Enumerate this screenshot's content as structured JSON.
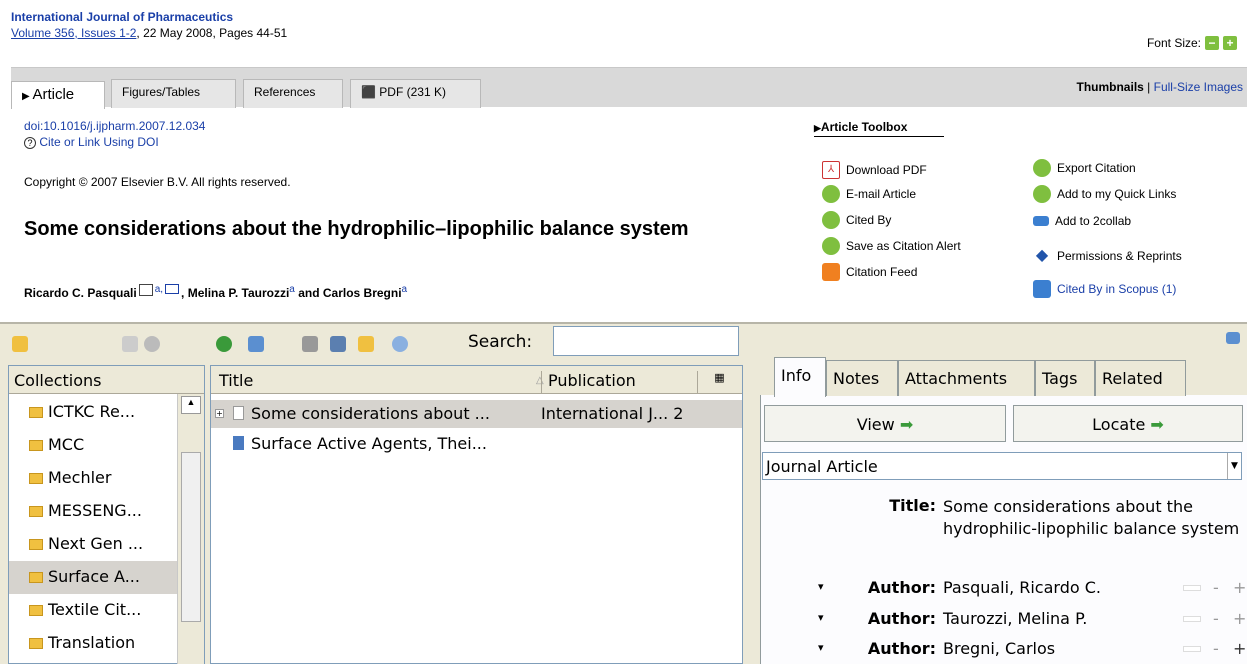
{
  "journal": {
    "name": "International Journal of Pharmaceutics",
    "volume_link": "Volume 356, Issues 1-2",
    "date_pages": ", 22 May 2008, Pages 44-51"
  },
  "font_size_label": "Font Size:",
  "tabs": [
    "Article",
    "Figures/Tables",
    "References",
    "PDF (231 K)"
  ],
  "thumbs": {
    "thumbnails": "Thumbnails",
    "sep": " | ",
    "fullsize": "Full-Size Images"
  },
  "doi": "doi:10.1016/j.ijpharm.2007.12.034",
  "cite_link": "Cite or Link Using DOI",
  "copyright": "Copyright © 2007 Elsevier B.V. All rights reserved.",
  "article_title": "Some considerations about the hydrophilic–lipophilic balance system",
  "authors": {
    "a1": "Ricardo C. Pasquali",
    "a1_sup": "a,",
    "a2": ", Melina P. Taurozzi",
    "a2_sup": "a",
    "a3": " and Carlos Bregni",
    "a3_sup": "a"
  },
  "toolbox": {
    "header": "Article Toolbox",
    "left": [
      "Download PDF",
      "E-mail Article",
      "Cited By",
      "Save as Citation Alert",
      "Citation Feed"
    ],
    "right": [
      "Export Citation",
      "Add to my Quick Links",
      "Add to 2collab",
      "Permissions & Reprints",
      "Cited By in Scopus (1)"
    ]
  },
  "zotero": {
    "search_label": "Search:",
    "collections_header": "Collections",
    "collections": [
      "ICTKC Re...",
      "MCC",
      "Mechler",
      "MESSENG...",
      "Next Gen ...",
      "Surface A...",
      "Textile Cit...",
      "Translation"
    ],
    "selected_collection": "Surface A...",
    "items_headers": {
      "title": "Title",
      "publication": "Publication"
    },
    "items": [
      {
        "title": "Some considerations about ...",
        "publication": "International J... 2"
      },
      {
        "title": "Surface Active Agents, Thei...",
        "publication": ""
      }
    ],
    "right_tabs": [
      "Info",
      "Notes",
      "Attachments",
      "Tags",
      "Related"
    ],
    "view_btn": "View",
    "locate_btn": "Locate",
    "item_type": "Journal Article",
    "fields": {
      "title_label": "Title:",
      "title_value": "Some considerations about the hydrophilic-lipophilic balance system",
      "author_label": "Author:",
      "authors": [
        "Pasquali, Ricardo C.",
        "Taurozzi, Melina P.",
        "Bregni, Carlos"
      ]
    }
  }
}
